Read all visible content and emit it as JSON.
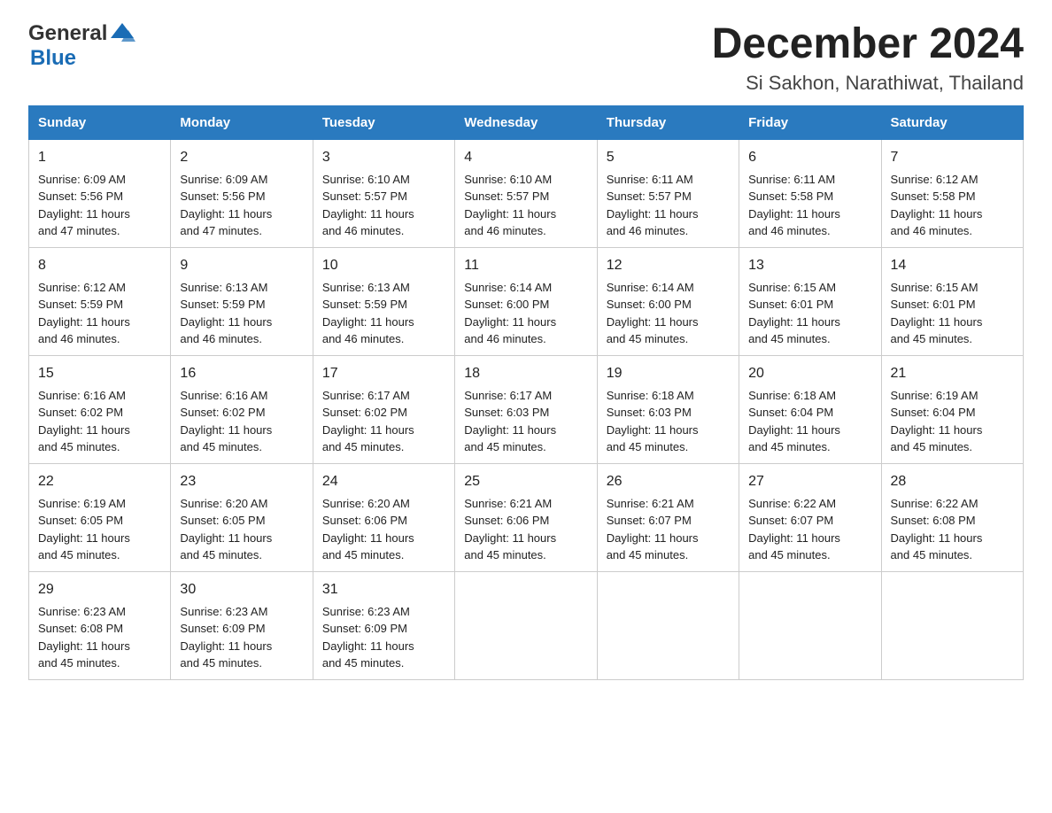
{
  "header": {
    "logo_general": "General",
    "logo_blue": "Blue",
    "title": "December 2024",
    "subtitle": "Si Sakhon, Narathiwat, Thailand"
  },
  "days_of_week": [
    "Sunday",
    "Monday",
    "Tuesday",
    "Wednesday",
    "Thursday",
    "Friday",
    "Saturday"
  ],
  "weeks": [
    [
      {
        "day": "1",
        "info": "Sunrise: 6:09 AM\nSunset: 5:56 PM\nDaylight: 11 hours\nand 47 minutes."
      },
      {
        "day": "2",
        "info": "Sunrise: 6:09 AM\nSunset: 5:56 PM\nDaylight: 11 hours\nand 47 minutes."
      },
      {
        "day": "3",
        "info": "Sunrise: 6:10 AM\nSunset: 5:57 PM\nDaylight: 11 hours\nand 46 minutes."
      },
      {
        "day": "4",
        "info": "Sunrise: 6:10 AM\nSunset: 5:57 PM\nDaylight: 11 hours\nand 46 minutes."
      },
      {
        "day": "5",
        "info": "Sunrise: 6:11 AM\nSunset: 5:57 PM\nDaylight: 11 hours\nand 46 minutes."
      },
      {
        "day": "6",
        "info": "Sunrise: 6:11 AM\nSunset: 5:58 PM\nDaylight: 11 hours\nand 46 minutes."
      },
      {
        "day": "7",
        "info": "Sunrise: 6:12 AM\nSunset: 5:58 PM\nDaylight: 11 hours\nand 46 minutes."
      }
    ],
    [
      {
        "day": "8",
        "info": "Sunrise: 6:12 AM\nSunset: 5:59 PM\nDaylight: 11 hours\nand 46 minutes."
      },
      {
        "day": "9",
        "info": "Sunrise: 6:13 AM\nSunset: 5:59 PM\nDaylight: 11 hours\nand 46 minutes."
      },
      {
        "day": "10",
        "info": "Sunrise: 6:13 AM\nSunset: 5:59 PM\nDaylight: 11 hours\nand 46 minutes."
      },
      {
        "day": "11",
        "info": "Sunrise: 6:14 AM\nSunset: 6:00 PM\nDaylight: 11 hours\nand 46 minutes."
      },
      {
        "day": "12",
        "info": "Sunrise: 6:14 AM\nSunset: 6:00 PM\nDaylight: 11 hours\nand 45 minutes."
      },
      {
        "day": "13",
        "info": "Sunrise: 6:15 AM\nSunset: 6:01 PM\nDaylight: 11 hours\nand 45 minutes."
      },
      {
        "day": "14",
        "info": "Sunrise: 6:15 AM\nSunset: 6:01 PM\nDaylight: 11 hours\nand 45 minutes."
      }
    ],
    [
      {
        "day": "15",
        "info": "Sunrise: 6:16 AM\nSunset: 6:02 PM\nDaylight: 11 hours\nand 45 minutes."
      },
      {
        "day": "16",
        "info": "Sunrise: 6:16 AM\nSunset: 6:02 PM\nDaylight: 11 hours\nand 45 minutes."
      },
      {
        "day": "17",
        "info": "Sunrise: 6:17 AM\nSunset: 6:02 PM\nDaylight: 11 hours\nand 45 minutes."
      },
      {
        "day": "18",
        "info": "Sunrise: 6:17 AM\nSunset: 6:03 PM\nDaylight: 11 hours\nand 45 minutes."
      },
      {
        "day": "19",
        "info": "Sunrise: 6:18 AM\nSunset: 6:03 PM\nDaylight: 11 hours\nand 45 minutes."
      },
      {
        "day": "20",
        "info": "Sunrise: 6:18 AM\nSunset: 6:04 PM\nDaylight: 11 hours\nand 45 minutes."
      },
      {
        "day": "21",
        "info": "Sunrise: 6:19 AM\nSunset: 6:04 PM\nDaylight: 11 hours\nand 45 minutes."
      }
    ],
    [
      {
        "day": "22",
        "info": "Sunrise: 6:19 AM\nSunset: 6:05 PM\nDaylight: 11 hours\nand 45 minutes."
      },
      {
        "day": "23",
        "info": "Sunrise: 6:20 AM\nSunset: 6:05 PM\nDaylight: 11 hours\nand 45 minutes."
      },
      {
        "day": "24",
        "info": "Sunrise: 6:20 AM\nSunset: 6:06 PM\nDaylight: 11 hours\nand 45 minutes."
      },
      {
        "day": "25",
        "info": "Sunrise: 6:21 AM\nSunset: 6:06 PM\nDaylight: 11 hours\nand 45 minutes."
      },
      {
        "day": "26",
        "info": "Sunrise: 6:21 AM\nSunset: 6:07 PM\nDaylight: 11 hours\nand 45 minutes."
      },
      {
        "day": "27",
        "info": "Sunrise: 6:22 AM\nSunset: 6:07 PM\nDaylight: 11 hours\nand 45 minutes."
      },
      {
        "day": "28",
        "info": "Sunrise: 6:22 AM\nSunset: 6:08 PM\nDaylight: 11 hours\nand 45 minutes."
      }
    ],
    [
      {
        "day": "29",
        "info": "Sunrise: 6:23 AM\nSunset: 6:08 PM\nDaylight: 11 hours\nand 45 minutes."
      },
      {
        "day": "30",
        "info": "Sunrise: 6:23 AM\nSunset: 6:09 PM\nDaylight: 11 hours\nand 45 minutes."
      },
      {
        "day": "31",
        "info": "Sunrise: 6:23 AM\nSunset: 6:09 PM\nDaylight: 11 hours\nand 45 minutes."
      },
      {
        "day": "",
        "info": ""
      },
      {
        "day": "",
        "info": ""
      },
      {
        "day": "",
        "info": ""
      },
      {
        "day": "",
        "info": ""
      }
    ]
  ]
}
